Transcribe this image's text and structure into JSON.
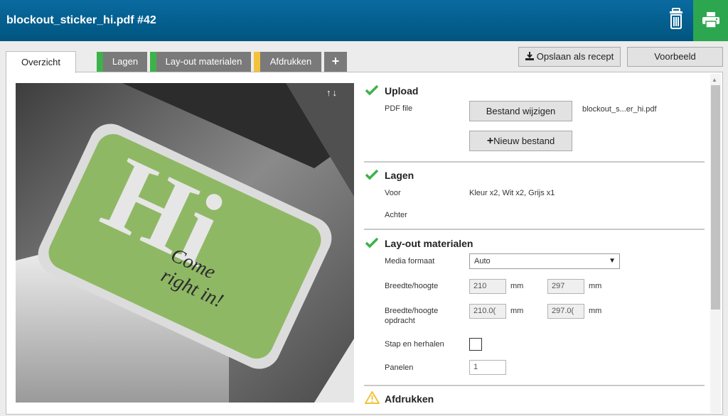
{
  "header": {
    "title": "blockout_sticker_hi.pdf #42"
  },
  "tabs": [
    {
      "label": "Overzicht",
      "marker": ""
    },
    {
      "label": "Lagen",
      "marker": "#3db24a"
    },
    {
      "label": "Lay-out materialen",
      "marker": "#3db24a"
    },
    {
      "label": "Afdrukken",
      "marker": "#f2c23a"
    },
    {
      "label": "+",
      "marker": ""
    }
  ],
  "toolbar": {
    "save_recipe_label": "Opslaan als recept",
    "preview_label": "Voorbeeld"
  },
  "preview": {
    "big_text": "Hi",
    "script_line1": "Come",
    "script_line2": "right in!",
    "controls": "↑↓"
  },
  "upload": {
    "title": "Upload",
    "pdf_label": "PDF file",
    "change_file_label": "Bestand wijzigen",
    "file_name": "blockout_s...er_hi.pdf",
    "new_file_label": "Nieuw bestand",
    "new_file_icon": "+"
  },
  "layers": {
    "title": "Lagen",
    "front_label": "Voor",
    "front_value": "Kleur x2, Wit x2, Grijs x1",
    "back_label": "Achter"
  },
  "layout": {
    "title": "Lay-out materialen",
    "media_label": "Media formaat",
    "media_value": "Auto",
    "wh_label": "Breedte/hoogte",
    "width": "210",
    "height": "297",
    "unit": "mm",
    "wh_job_label_line1": "Breedte/hoogte",
    "wh_job_label_line2": "opdracht",
    "job_width": "210.0(",
    "job_height": "297.0(",
    "step_repeat_label": "Stap en herhalen",
    "panels_label": "Panelen",
    "panels_value": "1"
  },
  "print": {
    "title": "Afdrukken"
  },
  "colors": {
    "header_blue": "#0a6aa0",
    "print_green": "#2da650",
    "check_green": "#3db24a",
    "warning_yellow": "#f2c23a",
    "sticker_green": "#8fb865"
  }
}
